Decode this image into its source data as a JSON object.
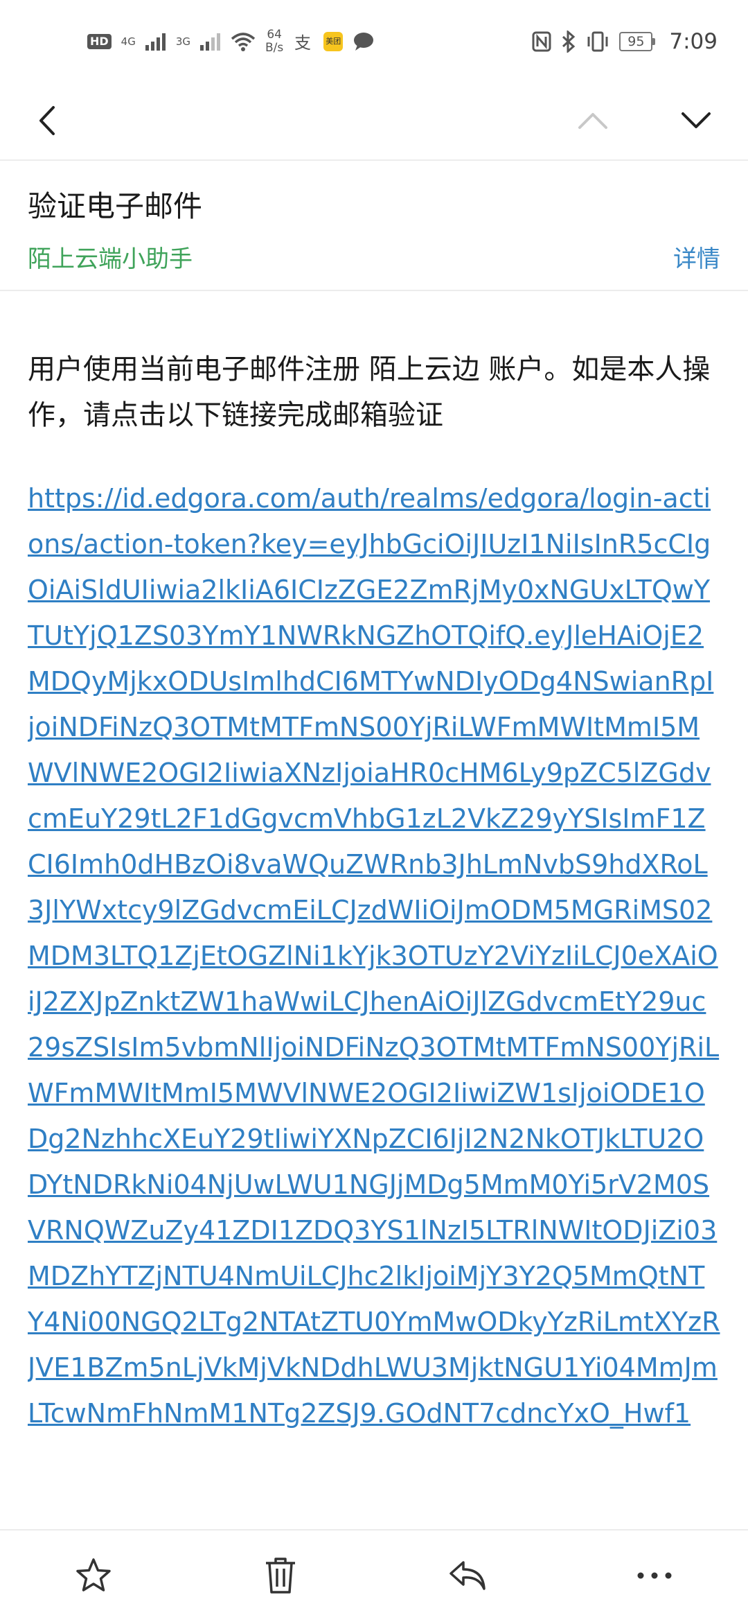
{
  "status_bar": {
    "hd_label": "HD",
    "signal1_label": "4G",
    "signal2_label": "3G",
    "speed_value": "64",
    "speed_unit": "B/s",
    "app_yellow_label": "美团",
    "battery_level": "95",
    "time": "7:09"
  },
  "toolbar": {
    "back_icon": "chevron-left",
    "prev_icon": "chevron-up",
    "next_icon": "chevron-down"
  },
  "email": {
    "subject": "验证电子邮件",
    "sender": "陌上云端小助手",
    "details_label": "详情",
    "message": "用户使用当前电子邮件注册 陌上云边 账户。如是本人操作，请点击以下链接完成邮箱验证",
    "link": "https://id.edgora.com/auth/realms/edgora/login-actions/action-token?key=eyJhbGciOiJIUzI1NiIsInR5cCIgOiAiSldUIiwia2lkIiA6ICIzZGE2ZmRjMy0xNGUxLTQwYTUtYjQ1ZS03YmY1NWRkNGZhOTQifQ.eyJleHAiOjE2MDQyMjkxODUsImlhdCI6MTYwNDIyODg4NSwianRpIjoiNDFiNzQ3OTMtMTFmNS00YjRiLWFmMWItMmI5MWVlNWE2OGI2IiwiaXNzIjoiaHR0cHM6Ly9pZC5lZGdvcmEuY29tL2F1dGgvcmVhbG1zL2VkZ29yYSIsImF1ZCI6Imh0dHBzOi8vaWQuZWRnb3JhLmNvbS9hdXRoL3JlYWxtcy9lZGdvcmEiLCJzdWIiOiJmODM5MGRiMS02MDM3LTQ1ZjEtOGZlNi1kYjk3OTUzY2ViYzIiLCJ0eXAiOiJ2ZXJpZnktZW1haWwiLCJhenAiOiJlZGdvcmEtY29uc29sZSIsIm5vbmNlIjoiNDFiNzQ3OTMtMTFmNS00YjRiLWFmMWItMmI5MWVlNWE2OGI2IiwiZW1sIjoiODE1ODg2NzhhcXEuY29tIiwiYXNpZCI6IjI2N2NkOTJkLTU2ODYtNDRkNi04NjUwLWU1NGJjMDg5MmM0Yi5rV2M0SVRNQWZuZy41ZDI1ZDQ3YS1lNzI5LTRlNWItODJiZi03MDZhYTZjNTU4NmUiLCJhc2lkIjoiMjY3Y2Q5MmQtNTY4Ni00NGQ2LTg2NTAtZTU0YmMwODkyYzRiLmtXYzRJVE1BZm5nLjVkMjVkNDdhLWU3MjktNGU1Yi04MmJmLTcwNmFhNmM1NTg2ZSJ9.GOdNT7cdncYxO_Hwf1"
  },
  "bottom_bar": {
    "star_icon": "star-outline",
    "delete_icon": "trash",
    "reply_icon": "reply",
    "more_icon": "more-horizontal"
  }
}
